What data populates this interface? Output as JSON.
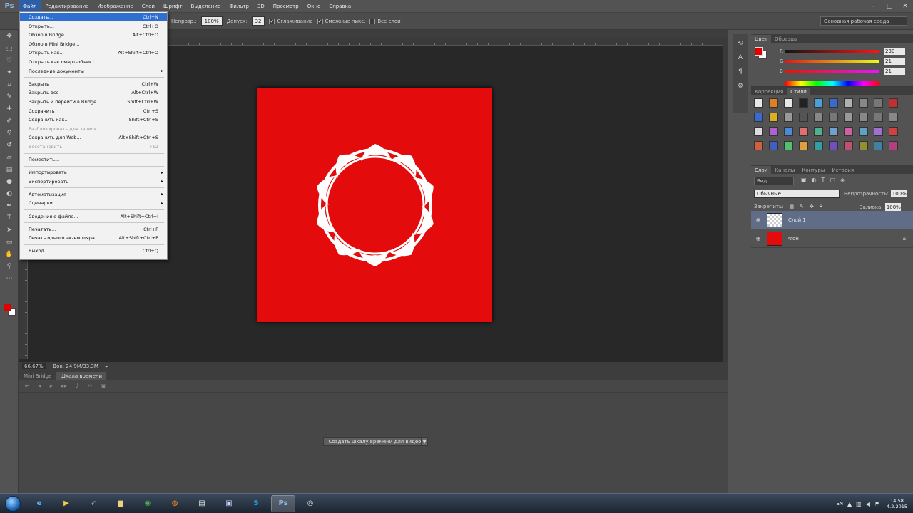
{
  "app": {
    "logo": "Ps"
  },
  "menubar": {
    "items": [
      "Файл",
      "Редактирование",
      "Изображение",
      "Слои",
      "Шрифт",
      "Выделение",
      "Фильтр",
      "3D",
      "Просмотр",
      "Окно",
      "Справка"
    ]
  },
  "window_controls": {
    "minimize": "–",
    "maximize": "□",
    "close": "✕"
  },
  "options": {
    "opacity_label": "Непрозр.:",
    "opacity_value": "100%",
    "flow_label": "Допуск:",
    "flow_value": "32",
    "antialias_label": "Сглаживание",
    "contiguous_label": "Смежные пикс.",
    "all_layers_label": "Все слои",
    "workspace": "Основная рабочая среда"
  },
  "file_menu": {
    "items": [
      {
        "label": "Создать...",
        "shortcut": "Ctrl+N",
        "highlight": true
      },
      {
        "label": "Открыть...",
        "shortcut": "Ctrl+O"
      },
      {
        "label": "Обзор в Bridge...",
        "shortcut": "Alt+Ctrl+O"
      },
      {
        "label": "Обзор в Mini Bridge...",
        "shortcut": ""
      },
      {
        "label": "Открыть как...",
        "shortcut": "Alt+Shift+Ctrl+O"
      },
      {
        "label": "Открыть как смарт-объект...",
        "shortcut": ""
      },
      {
        "label": "Последние документы",
        "shortcut": "",
        "submenu": true
      },
      {
        "label": "Закрыть",
        "shortcut": "Ctrl+W"
      },
      {
        "label": "Закрыть все",
        "shortcut": "Alt+Ctrl+W"
      },
      {
        "label": "Закрыть и перейти в Bridge...",
        "shortcut": "Shift+Ctrl+W"
      },
      {
        "label": "Сохранить",
        "shortcut": "Ctrl+S"
      },
      {
        "label": "Сохранить как...",
        "shortcut": "Shift+Ctrl+S"
      },
      {
        "label": "Разблокировать для записи...",
        "shortcut": "",
        "disabled": true
      },
      {
        "label": "Сохранить для Web...",
        "shortcut": "Alt+Shift+Ctrl+S"
      },
      {
        "label": "Восстановить",
        "shortcut": "F12",
        "disabled": true
      },
      {
        "label": "Поместить...",
        "shortcut": ""
      },
      {
        "label": "Импортировать",
        "shortcut": "",
        "submenu": true
      },
      {
        "label": "Экспортировать",
        "shortcut": "",
        "submenu": true
      },
      {
        "label": "Автоматизация",
        "shortcut": "",
        "submenu": true
      },
      {
        "label": "Сценарии",
        "shortcut": "",
        "submenu": true
      },
      {
        "label": "Сведения о файле...",
        "shortcut": "Alt+Shift+Ctrl+I"
      },
      {
        "label": "Печатать...",
        "shortcut": "Ctrl+P"
      },
      {
        "label": "Печать одного экземпляра",
        "shortcut": "Alt+Shift+Ctrl+P"
      },
      {
        "label": "Выход",
        "shortcut": "Ctrl+Q"
      }
    ],
    "submenu_arrow": "▸"
  },
  "status": {
    "zoom": "66,67%",
    "doc": "Док: 24,9M/33,3M",
    "arrow": "▸"
  },
  "bottom_panel": {
    "tabs": [
      "Mini Bridge",
      "Шкала времени"
    ],
    "active_tab": 1,
    "create_button": "Создать шкалу времени для видео",
    "dropdown_arrow": "▼"
  },
  "color_panel": {
    "tabs": [
      "Цвет",
      "Образцы"
    ],
    "sliders": [
      {
        "label": "R",
        "value": "230"
      },
      {
        "label": "G",
        "value": "21"
      },
      {
        "label": "B",
        "value": "21"
      }
    ]
  },
  "swatches_panel": {
    "tabs": [
      "Коррекция",
      "Стили"
    ]
  },
  "layers_panel": {
    "tabs": [
      "Слои",
      "Каналы",
      "Контуры",
      "История"
    ],
    "filter": "Вид",
    "blend_mode": "Обычные",
    "opacity_label": "Непрозрачность:",
    "opacity_value": "100%",
    "lock_label": "Закрепить:",
    "fill_label": "Заливка:",
    "fill_value": "100%",
    "layers": [
      {
        "name": "Слой 1",
        "selected": true,
        "thumb": "transparent"
      },
      {
        "name": "Фон",
        "selected": false,
        "thumb": "red",
        "locked": true
      }
    ]
  },
  "taskbar": {
    "clock_time": "14:58",
    "clock_date": "4.2.2015",
    "lang": "EN"
  },
  "colors": {
    "canvas": "#e30b0b",
    "menu_highlight": "#2f6fd0",
    "selected_layer": "#5f6e86"
  }
}
